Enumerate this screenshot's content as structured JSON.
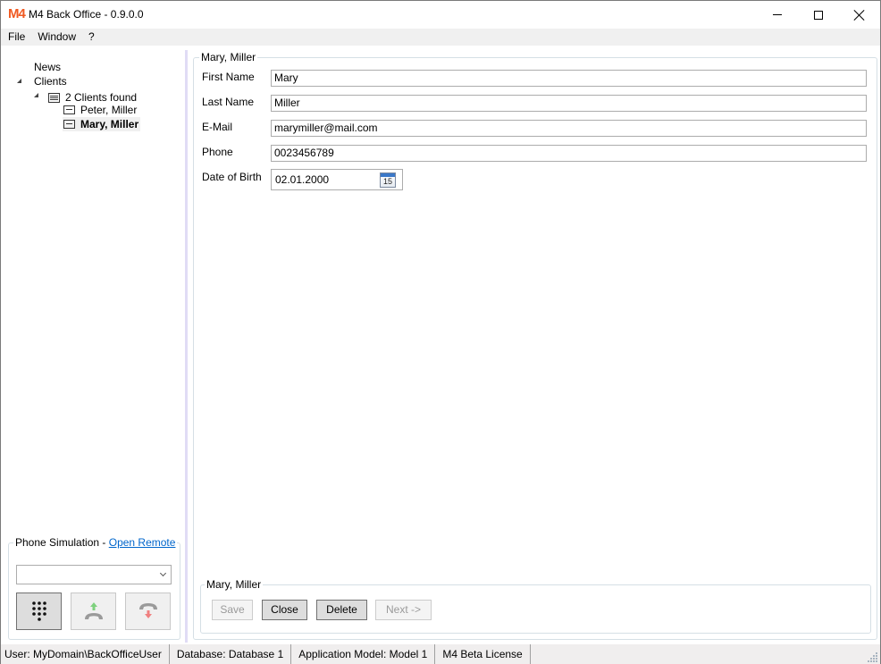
{
  "window": {
    "title": "M4 Back Office - 0.9.0.0",
    "logo_text": "M4",
    "brand_color": "#f05a22",
    "controls": [
      "minimize-icon",
      "maximize-icon",
      "close-icon"
    ]
  },
  "menu": {
    "items": [
      {
        "label": "File"
      },
      {
        "label": "Window"
      },
      {
        "label": "?"
      }
    ]
  },
  "tree": {
    "nodes": [
      {
        "label": "News",
        "level": 0,
        "expanded": false
      },
      {
        "label": "Clients",
        "level": 0,
        "expanded": true
      },
      {
        "label": "2 Clients found",
        "level": 1,
        "expanded": true,
        "icon": "list-icon"
      },
      {
        "label": "Peter, Miller",
        "level": 2,
        "icon": "record-icon",
        "selected": false
      },
      {
        "label": "Mary, Miller",
        "level": 2,
        "icon": "record-icon",
        "selected": true
      }
    ]
  },
  "phone": {
    "legend_text": "Phone Simulation - ",
    "link_label": "Open Remote",
    "combo_value": "",
    "buttons": [
      {
        "name": "keypad",
        "icon": "keypad-icon"
      },
      {
        "name": "accept-call",
        "icon": "phone-pickup-icon",
        "accent": "#7ed17e"
      },
      {
        "name": "hang-up",
        "icon": "phone-hangup-icon",
        "accent": "#f08080"
      }
    ]
  },
  "detail": {
    "group_title": "Mary, Miller",
    "fields": [
      {
        "label": "First Name",
        "value": "Mary"
      },
      {
        "label": "Last Name",
        "value": "Miller"
      },
      {
        "label": "E-Mail",
        "value": "marymiller@mail.com"
      },
      {
        "label": "Phone",
        "value": "0023456789"
      }
    ],
    "dob": {
      "label": "Date of Birth",
      "value": "02.01.2000",
      "calendar_day": "15"
    }
  },
  "actions": {
    "group_title": "Mary, Miller",
    "buttons": [
      {
        "label": "Save",
        "enabled": false
      },
      {
        "label": "Close",
        "enabled": true
      },
      {
        "label": "Delete",
        "enabled": true
      },
      {
        "label": "Next ->",
        "enabled": false
      }
    ]
  },
  "status": {
    "items": [
      {
        "text": "User: MyDomain\\BackOfficeUser"
      },
      {
        "text": "Database: Database 1"
      },
      {
        "text": "Application Model: Model 1"
      },
      {
        "text": "M4 Beta License"
      }
    ]
  }
}
